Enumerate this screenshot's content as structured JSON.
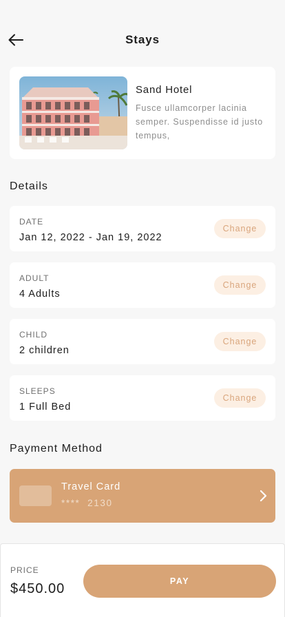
{
  "header": {
    "title": "Stays",
    "back_icon": "arrow-left-icon"
  },
  "hotel": {
    "name": "Sand Hotel",
    "description": "Fusce ullamcorper lacinia semper. Suspendisse id justo tempus,",
    "image": "hotel-photo"
  },
  "details": {
    "title": "Details",
    "items": [
      {
        "label": "DATE",
        "value": "Jan 12, 2022 - Jan 19, 2022",
        "action": "Change"
      },
      {
        "label": "ADULT",
        "value": "4 Adults",
        "action": "Change"
      },
      {
        "label": "CHILD",
        "value": "2 children",
        "action": "Change"
      },
      {
        "label": "SLEEPS",
        "value": "1 Full Bed",
        "action": "Change"
      }
    ]
  },
  "payment": {
    "title": "Payment Method",
    "card_name": "Travel Card",
    "card_number": "****  2130",
    "chevron_icon": "chevron-right-icon"
  },
  "checkout": {
    "price_label": "PRICE",
    "price": "$450.00",
    "pay_label": "PAY"
  },
  "colors": {
    "accent": "#d8a476",
    "accent_light": "#fcefe3",
    "background": "#f7f7f7"
  }
}
